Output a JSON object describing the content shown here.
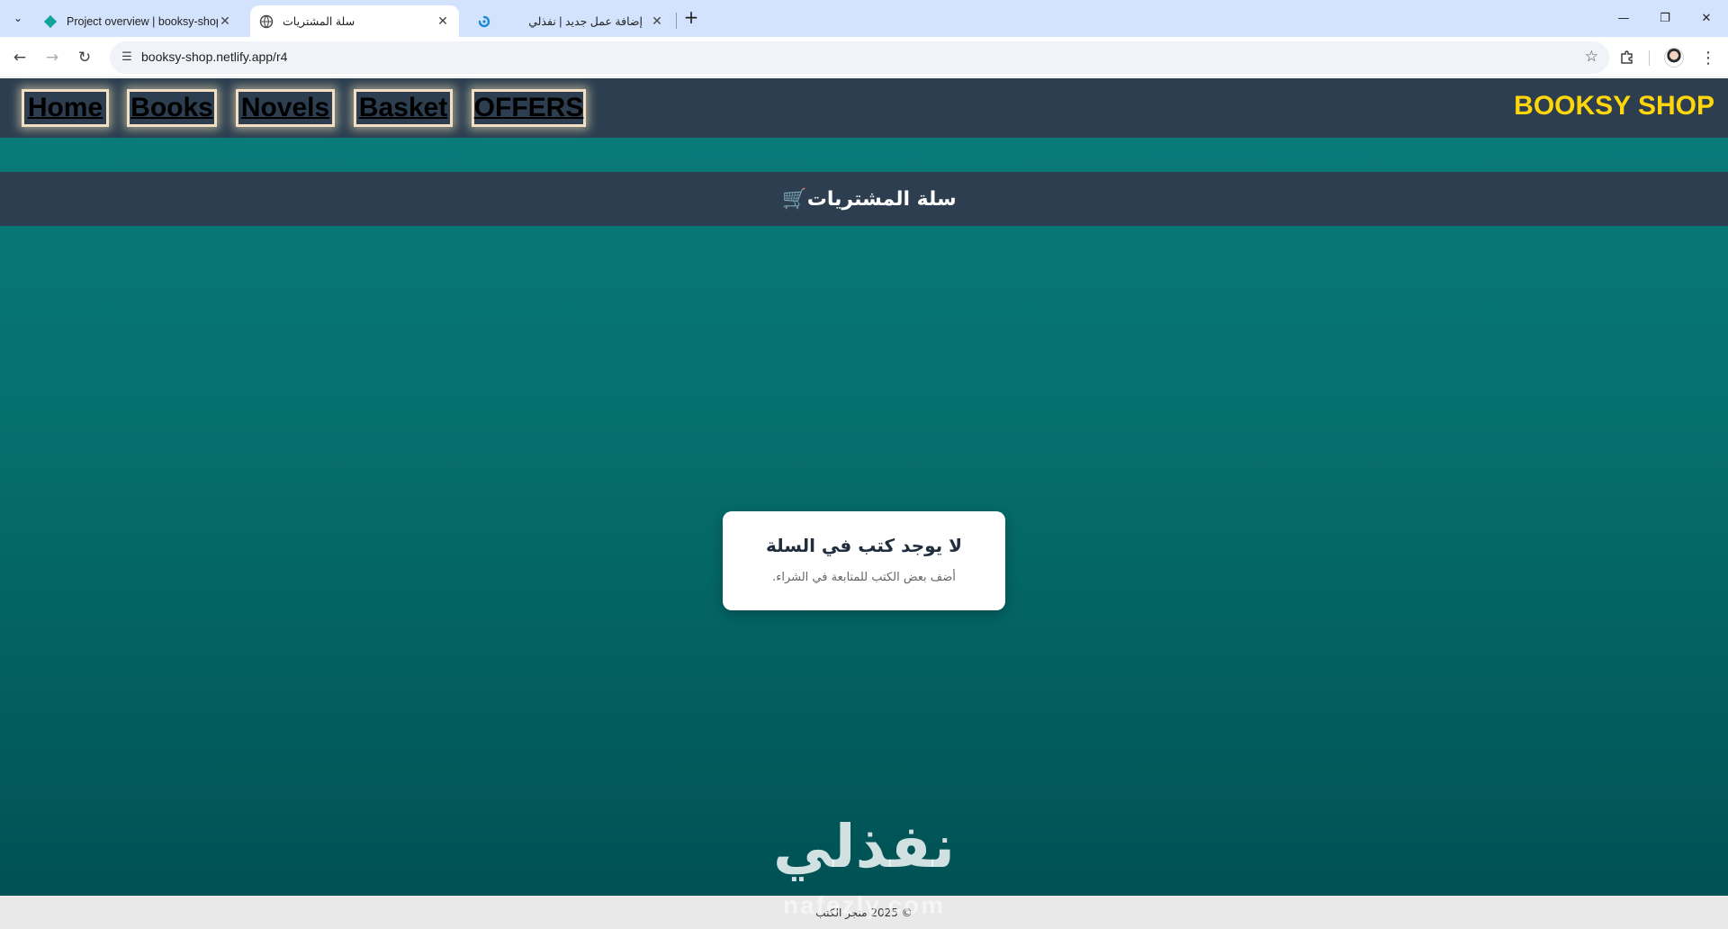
{
  "browser": {
    "tabs": [
      {
        "title": "Project overview | booksy-shop",
        "favicon": "netlify-diamond-icon",
        "active": false
      },
      {
        "title": "سلة المشتريات",
        "favicon": "globe-icon",
        "active": true
      },
      {
        "title": "إضافة عمل جديد | نفذلي",
        "favicon": "nafezly-icon",
        "active": false
      }
    ],
    "new_tab": "+",
    "url": "booksy-shop.netlify.app/r4",
    "icons": {
      "back": "back-arrow-icon",
      "forward": "forward-arrow-icon",
      "reload": "reload-icon",
      "site_info": "site-info-icon",
      "bookmark": "star-icon",
      "extensions": "puzzle-icon",
      "profile": "avatar",
      "menu": "kebab-menu-icon"
    }
  },
  "site": {
    "brand": "BOOKSY SHOP",
    "nav": [
      "Home",
      "Books",
      "Novels",
      "Basket",
      "OFFERS"
    ],
    "page_title": "سلة المشتريات",
    "cart_icon": "🛒",
    "empty_title": "لا يوجد كتب في السلة",
    "empty_subtitle": "أضف بعض الكتب للمتابعة في الشراء.",
    "footer": "© 2025 متجر الكتب",
    "watermark_arabic": "نفذلي",
    "watermark_latin": "nafezly.com"
  },
  "colors": {
    "header_bg": "#2c3e50",
    "brand": "#ffd60a",
    "teal_top": "#087c7a",
    "teal_bottom": "#004f52",
    "nav_border": "#f2dfc4"
  }
}
